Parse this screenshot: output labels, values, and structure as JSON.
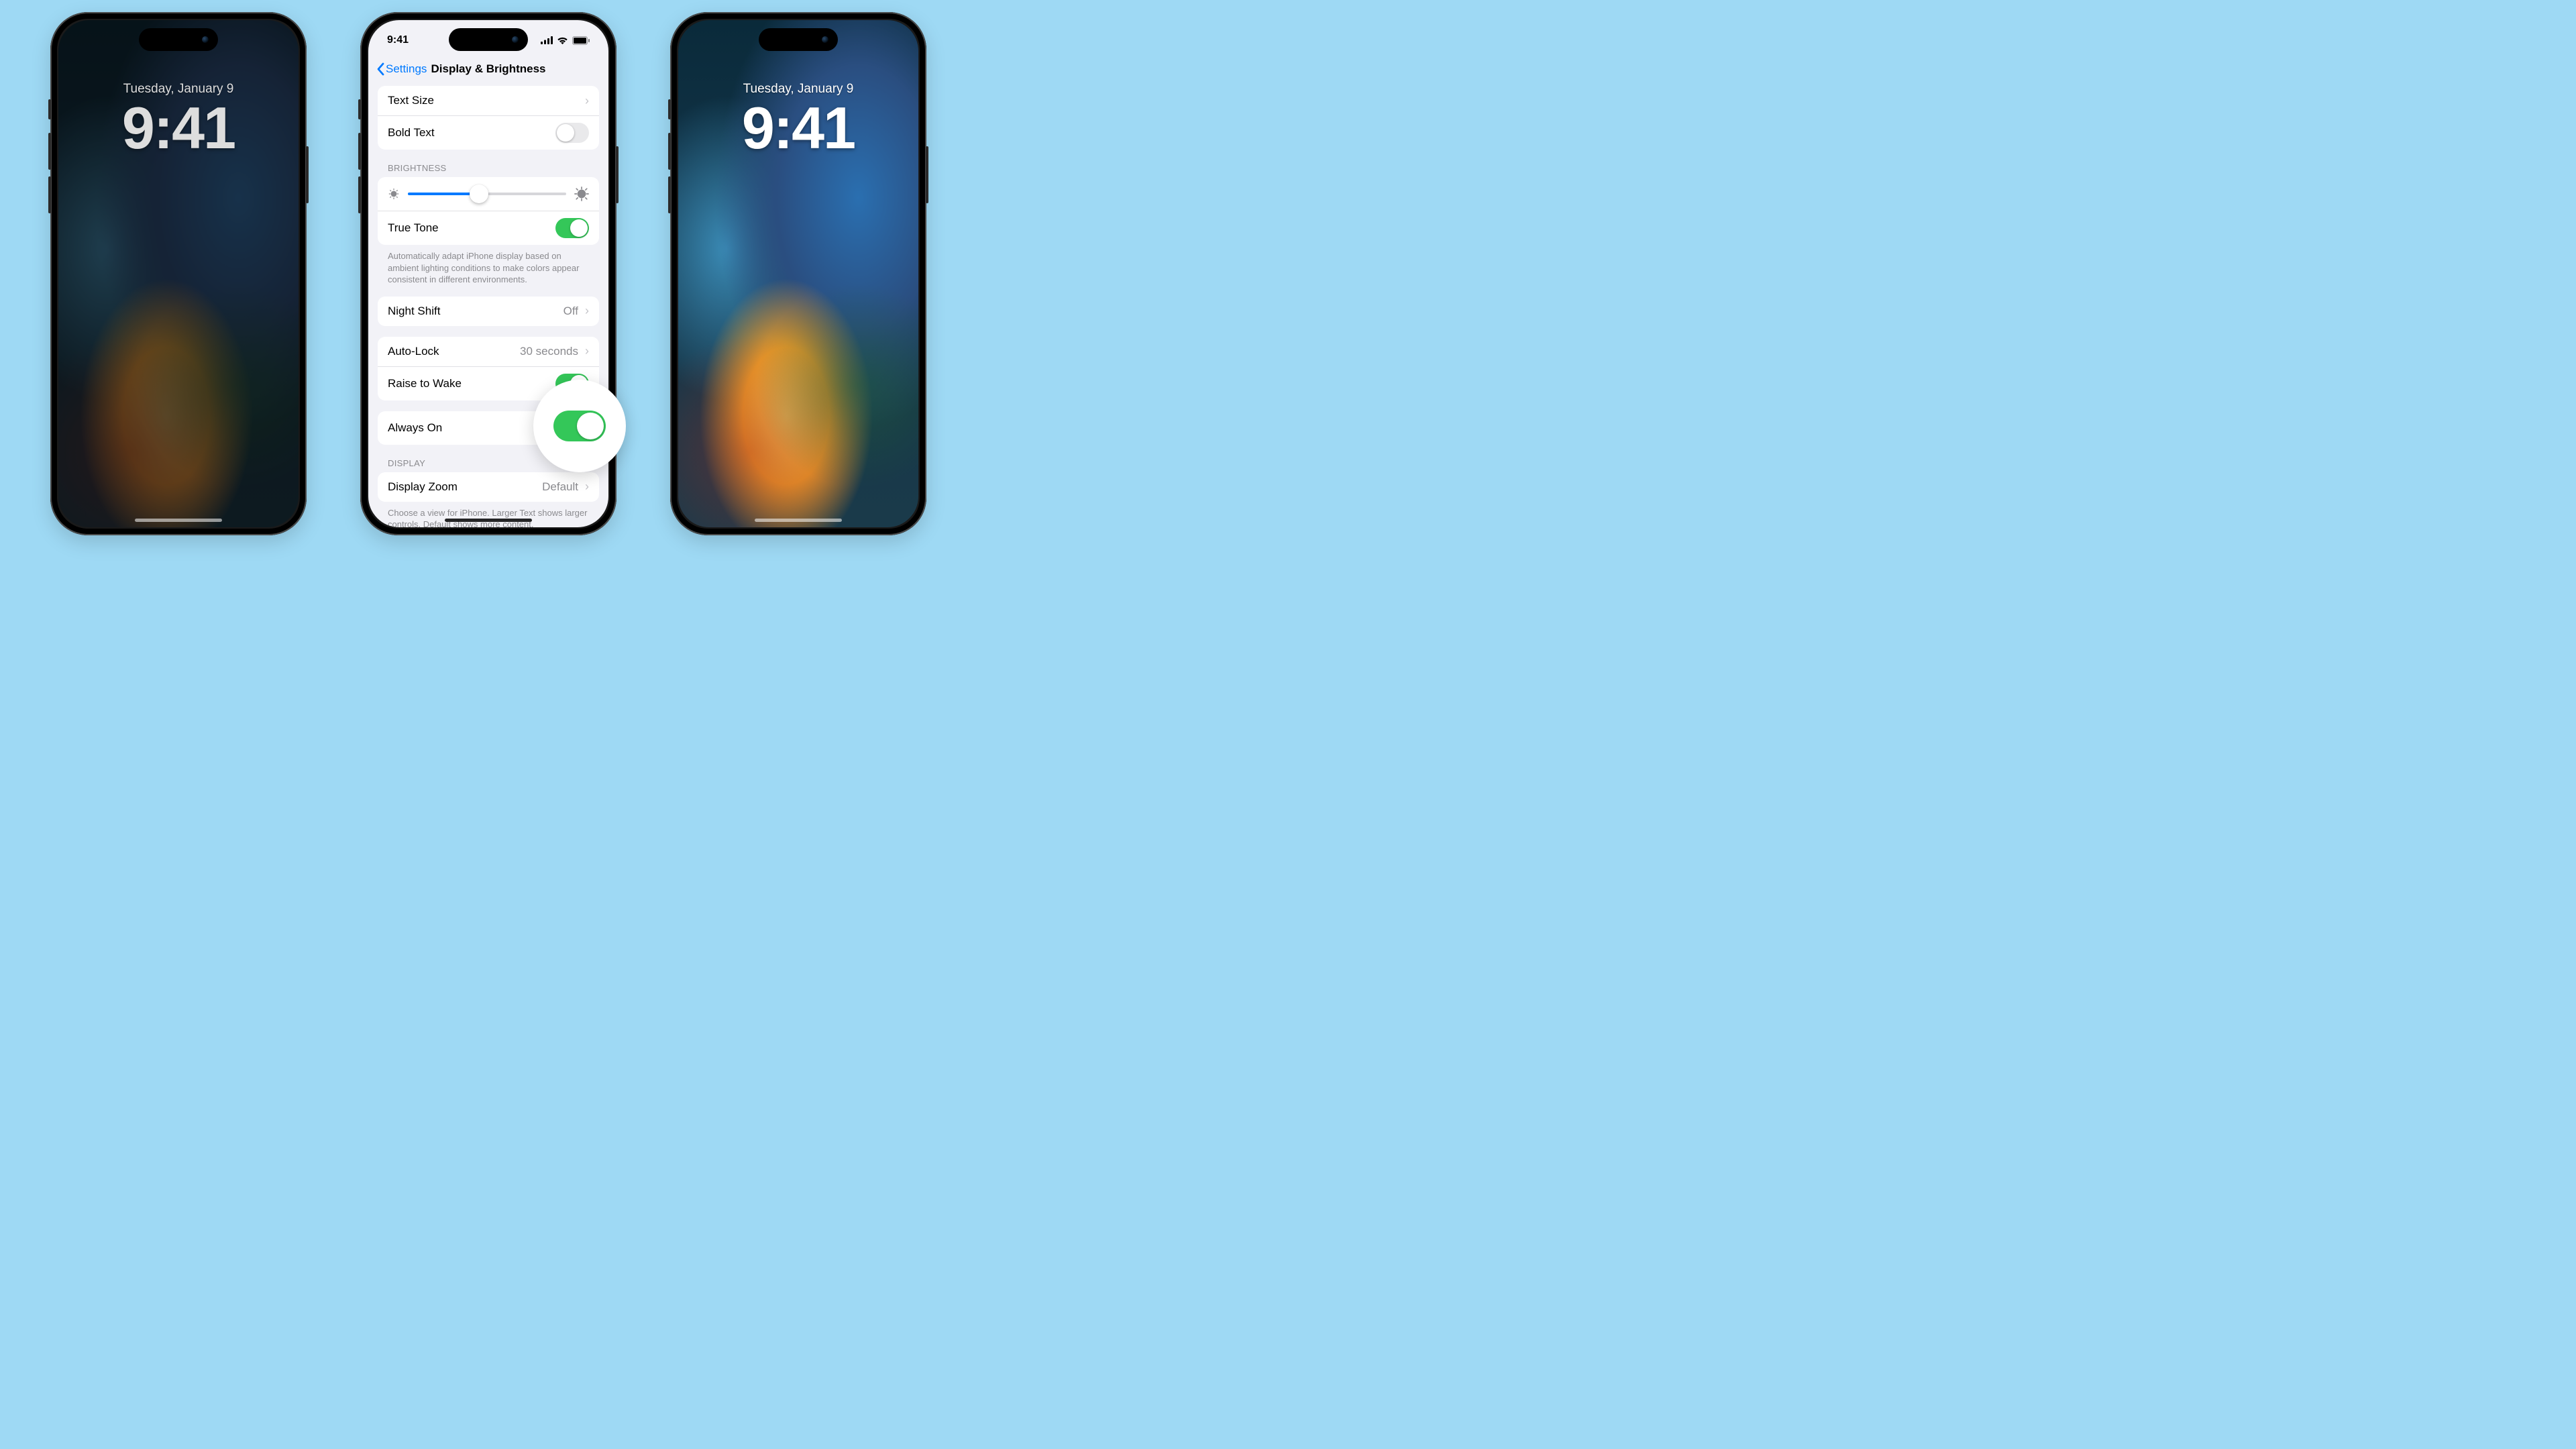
{
  "lock": {
    "date": "Tuesday, January 9",
    "time": "9:41",
    "lock_icon": "lock-icon"
  },
  "settings": {
    "status_time": "9:41",
    "back_label": "Settings",
    "title": "Display & Brightness",
    "rows": {
      "text_size": "Text Size",
      "bold_text": "Bold Text",
      "true_tone": "True Tone",
      "night_shift": "Night Shift",
      "night_shift_value": "Off",
      "auto_lock": "Auto-Lock",
      "auto_lock_value": "30 seconds",
      "raise_to_wake": "Raise to Wake",
      "always_on": "Always On",
      "display_zoom": "Display Zoom",
      "display_zoom_value": "Default"
    },
    "headers": {
      "brightness": "BRIGHTNESS",
      "display": "DISPLAY"
    },
    "footers": {
      "true_tone": "Automatically adapt iPhone display based on ambient lighting conditions to make colors appear consistent in different environments.",
      "display_zoom": "Choose a view for iPhone. Larger Text shows larger controls. Default shows more content."
    },
    "toggles": {
      "bold_text": false,
      "true_tone": true,
      "raise_to_wake": true,
      "always_on": true
    },
    "brightness_percent": 45
  }
}
